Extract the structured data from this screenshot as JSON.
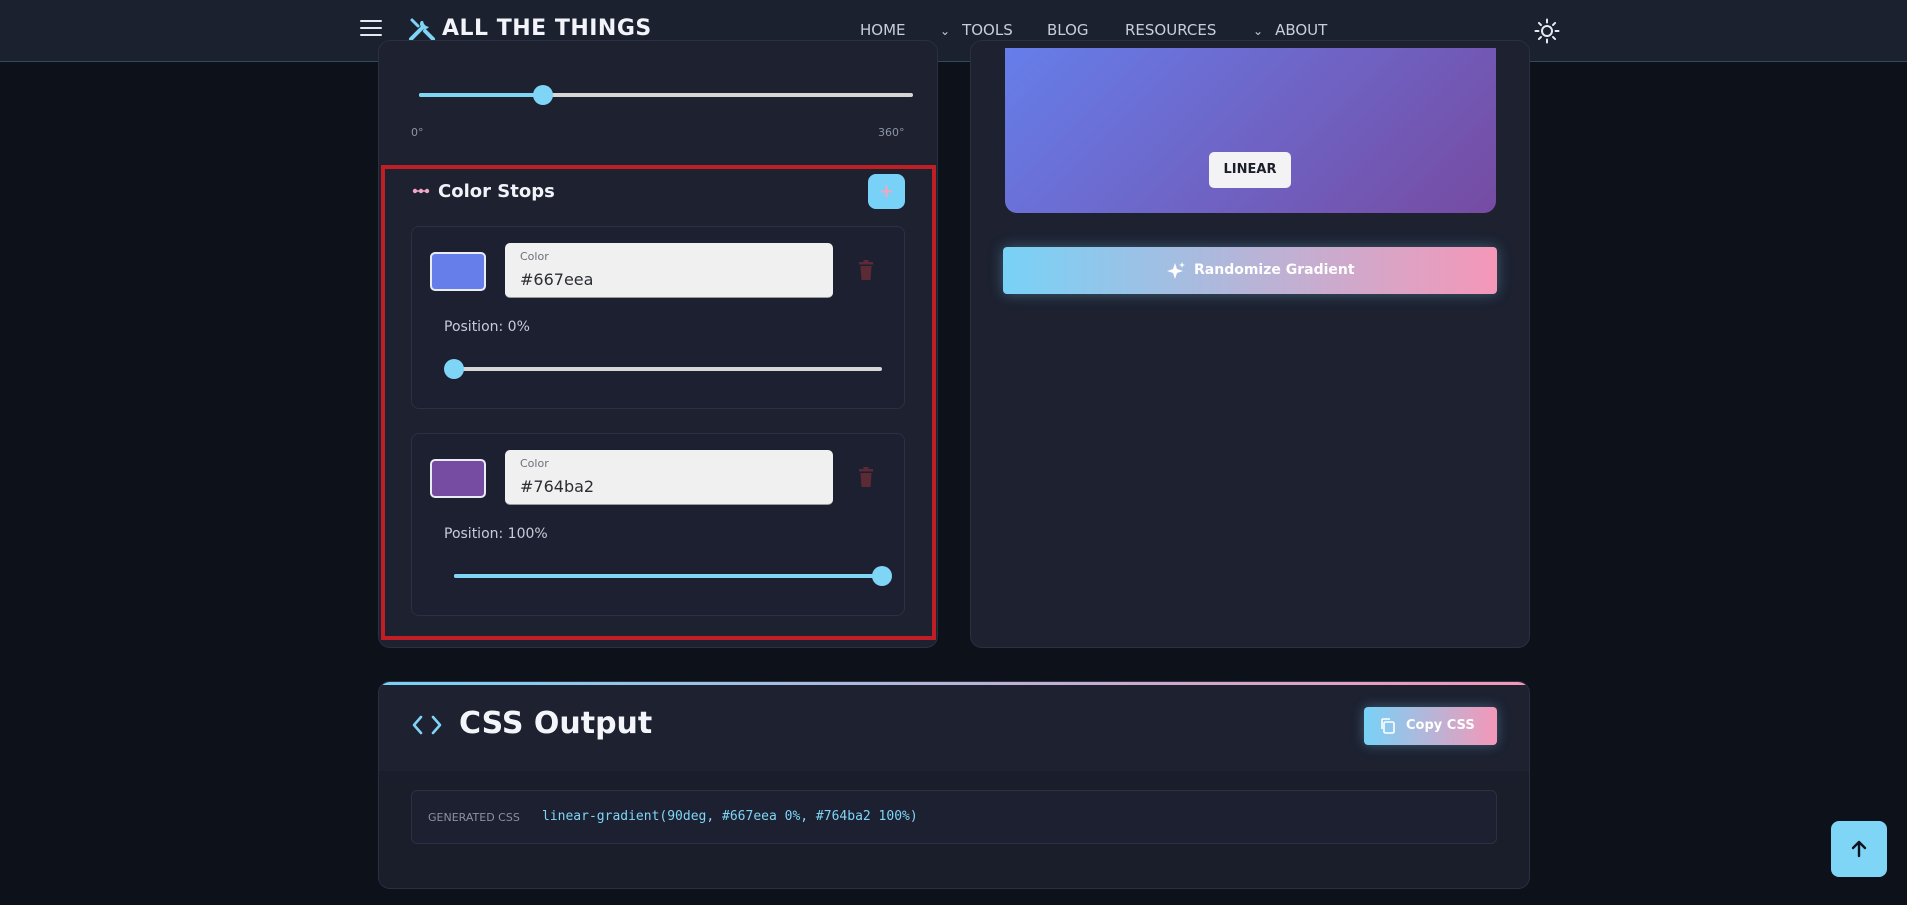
{
  "header": {
    "brand": "ALL THE THINGS",
    "nav": [
      {
        "label": "HOME",
        "has_dropdown": false
      },
      {
        "label": "TOOLS",
        "has_dropdown": true
      },
      {
        "label": "BLOG",
        "has_dropdown": false
      },
      {
        "label": "RESOURCES",
        "has_dropdown": false
      },
      {
        "label": "ABOUT",
        "has_dropdown": true
      }
    ],
    "icons": {
      "menu": "hamburger-icon",
      "logo": "tools-icon",
      "theme": "sun-icon"
    }
  },
  "angle": {
    "value_deg": 90,
    "min_label": "0°",
    "max_label": "360°",
    "min": 0,
    "max": 360
  },
  "color_stops": {
    "title": "Color Stops",
    "add_icon": "plus-icon",
    "stops": [
      {
        "field_label": "Color",
        "color": "#667eea",
        "position_label": "Position: 0%",
        "position": 0
      },
      {
        "field_label": "Color",
        "color": "#764ba2",
        "position_label": "Position: 100%",
        "position": 100
      }
    ]
  },
  "preview": {
    "badge": "LINEAR",
    "gradient_colors": [
      "#667eea",
      "#764ba2"
    ]
  },
  "randomize": {
    "label": "Randomize Gradient",
    "icon": "sparkle-icon"
  },
  "output": {
    "title": "CSS Output",
    "copy_label": "Copy CSS",
    "copy_icon": "copy-icon",
    "code_tag": "GENERATED CSS",
    "code": "linear-gradient(90deg, #667eea 0%, #764ba2 100%)"
  },
  "colors": {
    "accent_blue": "#78d2f7",
    "accent_pink": "#f597b8",
    "highlight_border": "#c01e25",
    "panel_bg": "#1d2130",
    "page_bg": "#0d111a"
  }
}
